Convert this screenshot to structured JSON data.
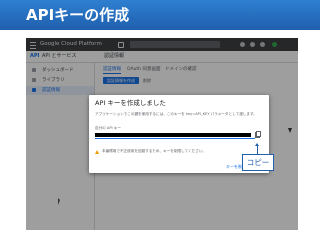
{
  "slide": {
    "title": "APIキーの作成"
  },
  "console": {
    "brand": "Google Cloud Platform",
    "subbar": {
      "api_badge": "API",
      "section_title": "API とサービス",
      "page_heading": "認証情報"
    },
    "sidebar": [
      {
        "label": "ダッシュボード",
        "icon": "dashboard-icon",
        "active": false
      },
      {
        "label": "ライブラリ",
        "icon": "library-icon",
        "active": false
      },
      {
        "label": "認証情報",
        "icon": "key-icon",
        "active": true
      }
    ],
    "tabs": [
      {
        "label": "認証情報",
        "active": true
      },
      {
        "label": "OAuth 同意画面",
        "active": false
      },
      {
        "label": "ドメインの確認",
        "active": false
      }
    ],
    "create_button": "認証情報を作成",
    "delete_button": "削除",
    "bg_text": "りして下さい。"
  },
  "dialog": {
    "title": "API キーを作成しました",
    "description": "アプリケーションでこの鍵を使用するには、このキーを key=API_KEY パラメータとして渡します。",
    "key_label": "自分の API キー",
    "warning": "本番環境で不正使用を回避するため、キーを制限してください。",
    "restrict_button": "キーを制限",
    "close_button": "閉じる"
  },
  "callout": {
    "label": "コピー"
  },
  "colors": {
    "header": "#1f5fae",
    "accent": "#1a73e8"
  }
}
